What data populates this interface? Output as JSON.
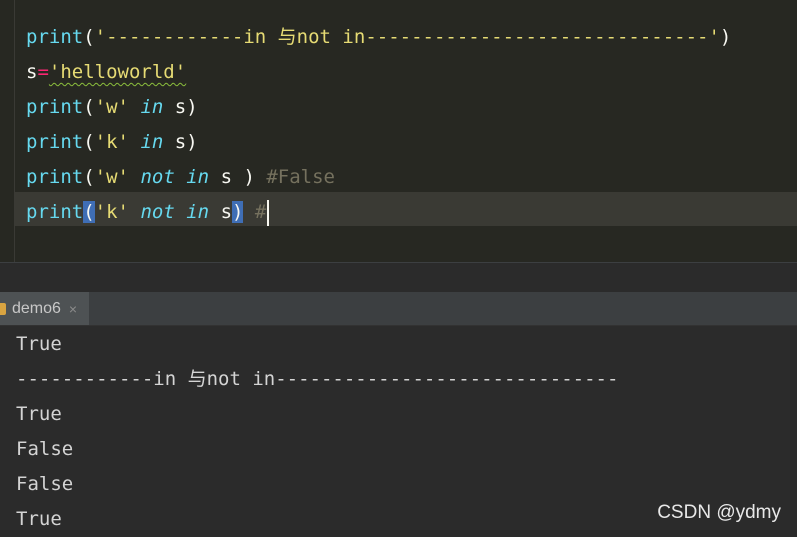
{
  "editor": {
    "lines": [
      {
        "print": "print",
        "open": "(",
        "str": "'------------in 与not in------------------------------'",
        "close": ")"
      },
      {
        "var": "s",
        "eq": "=",
        "str": "'helloworld'"
      },
      {
        "print": "print",
        "open": "(",
        "str": "'w'",
        "kw": "in",
        "rest": "s)"
      },
      {
        "print": "print",
        "open": "(",
        "str": "'k'",
        "kw": "in",
        "rest": "s)"
      },
      {
        "print": "print",
        "open": "(",
        "str": "'w'",
        "kw1": "not",
        "kw2": "in",
        "rest": "s )",
        "comment": "#False"
      },
      {
        "print": "print",
        "open": "(",
        "str": "'k'",
        "kw1": "not",
        "kw2": "in",
        "rest_a": "s",
        "close": ")",
        "comment": "#"
      }
    ]
  },
  "run": {
    "tab_label": "demo6",
    "close_glyph": "×",
    "output": [
      "True",
      "------------in 与not in------------------------------",
      "True",
      "False",
      "False",
      "True"
    ]
  },
  "watermark": "CSDN @ydmy",
  "colors": {
    "editor_bg": "#272822",
    "keyword": "#66d9ef",
    "string": "#e6db74",
    "comment": "#75715e",
    "operator": "#f92672",
    "console_bg": "#2b2b2b"
  }
}
